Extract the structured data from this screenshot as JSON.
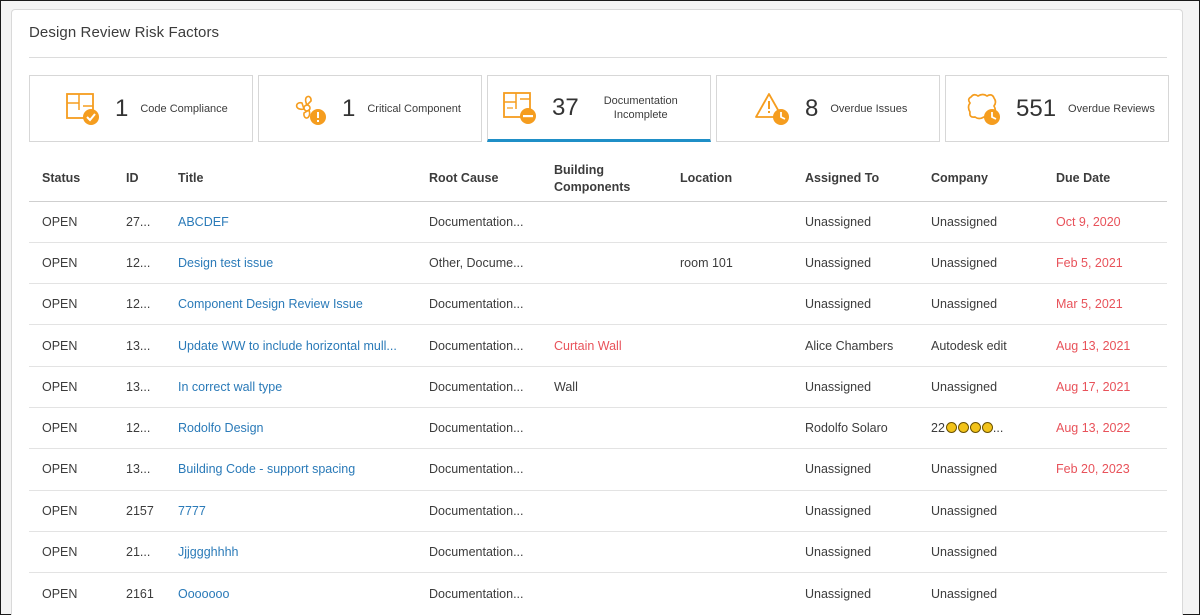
{
  "panel": {
    "title": "Design Review Risk Factors"
  },
  "cards": [
    {
      "icon": "code-compliance-icon",
      "count": "1",
      "label": "Code Compliance"
    },
    {
      "icon": "critical-component-icon",
      "count": "1",
      "label": "Critical Component"
    },
    {
      "icon": "documentation-incomplete-icon",
      "count": "37",
      "label": "Documentation Incomplete",
      "active": true
    },
    {
      "icon": "overdue-issues-icon",
      "count": "8",
      "label": "Overdue Issues"
    },
    {
      "icon": "overdue-reviews-icon",
      "count": "551",
      "label": "Overdue Reviews"
    }
  ],
  "colors": {
    "accent_orange": "#f59d1f",
    "link_blue": "#2a7ab8",
    "overdue_red": "#e8525a",
    "active_tab": "#1f8fc7"
  },
  "table": {
    "headers": {
      "status": "Status",
      "id": "ID",
      "title": "Title",
      "root_cause": "Root Cause",
      "building_components": "Building Components",
      "location": "Location",
      "assigned_to": "Assigned To",
      "company": "Company",
      "due_date": "Due Date"
    },
    "rows": [
      {
        "status": "OPEN",
        "id": "27...",
        "title": "ABCDEF",
        "root_cause": "Documentation...",
        "building_components": "",
        "location": "",
        "assigned_to": "Unassigned",
        "company": "Unassigned",
        "due_date": "Oct 9, 2020"
      },
      {
        "status": "OPEN",
        "id": "12...",
        "title": "Design test issue",
        "root_cause": "Other, Docume...",
        "building_components": "",
        "location": "room 101",
        "assigned_to": "Unassigned",
        "company": "Unassigned",
        "due_date": "Feb 5, 2021"
      },
      {
        "status": "OPEN",
        "id": "12...",
        "title": "Component Design Review Issue",
        "root_cause": "Documentation...",
        "building_components": "",
        "location": "",
        "assigned_to": "Unassigned",
        "company": "Unassigned",
        "due_date": "Mar 5, 2021"
      },
      {
        "status": "OPEN",
        "id": "13...",
        "title": "Update WW to include horizontal mull...",
        "root_cause": "Documentation...",
        "building_components": "Curtain Wall",
        "location": "",
        "assigned_to": "Alice Chambers",
        "company": "Autodesk edit",
        "due_date": "Aug 13, 2021"
      },
      {
        "status": "OPEN",
        "id": "13...",
        "title": "In correct wall type",
        "root_cause": "Documentation...",
        "building_components": "Wall",
        "location": "",
        "assigned_to": "Unassigned",
        "company": "Unassigned",
        "due_date": "Aug 17, 2021"
      },
      {
        "status": "OPEN",
        "id": "12...",
        "title": "Rodolfo Design",
        "root_cause": "Documentation...",
        "building_components": "",
        "location": "",
        "assigned_to": "Rodolfo Solaro",
        "company": "22",
        "company_suffix": "...",
        "due_date": "Aug 13, 2022"
      },
      {
        "status": "OPEN",
        "id": "13...",
        "title": "Building Code - support spacing",
        "root_cause": "Documentation...",
        "building_components": "",
        "location": "",
        "assigned_to": "Unassigned",
        "company": "Unassigned",
        "due_date": "Feb 20, 2023"
      },
      {
        "status": "OPEN",
        "id": "2157",
        "title": "7777",
        "root_cause": "Documentation...",
        "building_components": "",
        "location": "",
        "assigned_to": "Unassigned",
        "company": "Unassigned",
        "due_date": ""
      },
      {
        "status": "OPEN",
        "id": "21...",
        "title": "Jjjggghhhh",
        "root_cause": "Documentation...",
        "building_components": "",
        "location": "",
        "assigned_to": "Unassigned",
        "company": "Unassigned",
        "due_date": ""
      },
      {
        "status": "OPEN",
        "id": "2161",
        "title": "Ooooooo",
        "root_cause": "Documentation...",
        "building_components": "",
        "location": "",
        "assigned_to": "Unassigned",
        "company": "Unassigned",
        "due_date": ""
      }
    ]
  }
}
